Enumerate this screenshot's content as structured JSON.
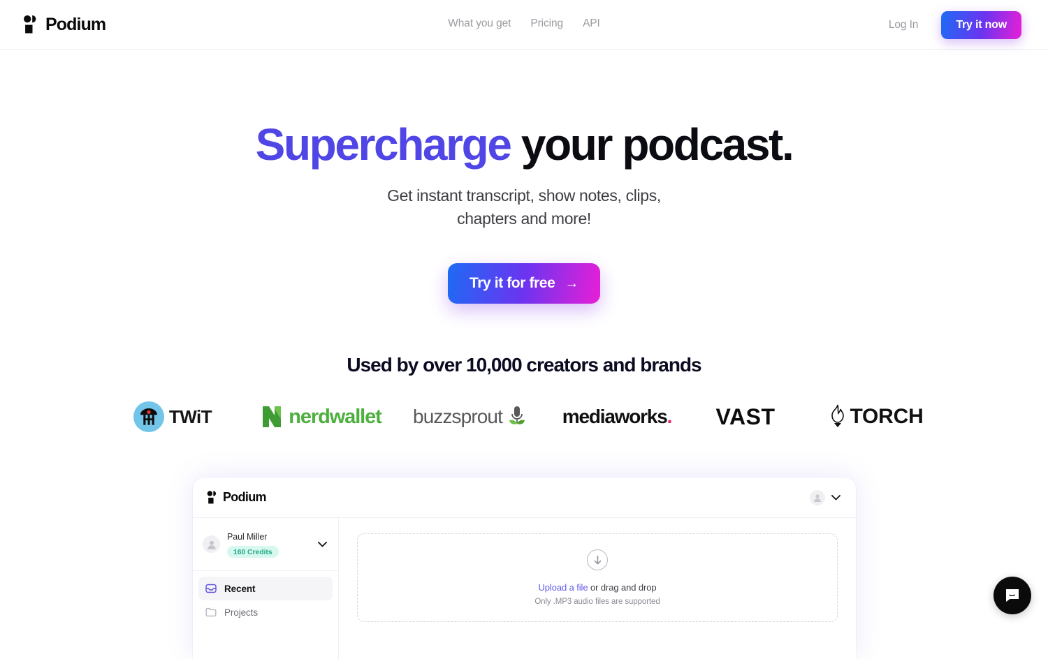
{
  "nav": {
    "brand": "Podium",
    "links": [
      {
        "label": "What you get"
      },
      {
        "label": "Pricing"
      },
      {
        "label": "API"
      }
    ],
    "login_label": "Log In",
    "cta_label": "Try it now"
  },
  "hero": {
    "headline_accent": "Supercharge",
    "headline_rest": " your podcast.",
    "accent_color": "#5046e5",
    "subhead_line1": "Get instant transcript, show notes, clips,",
    "subhead_line2": "chapters and more!",
    "cta_label": "Try it for free",
    "cta_arrow": "→"
  },
  "social_proof": {
    "title": "Used by over 10,000 creators and brands",
    "logos": [
      {
        "name": "TWiT",
        "text": "TWiT",
        "color": "#151515"
      },
      {
        "name": "nerdwallet",
        "text": "nerdwallet",
        "color": "#4caf3e"
      },
      {
        "name": "buzzsprout",
        "text": "buzzsprout",
        "color": "#58595b"
      },
      {
        "name": "mediaworks",
        "text": "mediaworks",
        "color": "#101010",
        "dot": "."
      },
      {
        "name": "VAST",
        "text": "VAST",
        "color": "#0c0c0c"
      },
      {
        "name": "TORCH",
        "text": "TORCH",
        "color": "#111111"
      }
    ]
  },
  "app_preview": {
    "brand": "Podium",
    "user": {
      "name": "Paul Miller",
      "credits_badge": "160 Credits"
    },
    "sidebar": [
      {
        "label": "Recent",
        "icon": "inbox-icon",
        "active": true
      },
      {
        "label": "Projects",
        "icon": "folder-icon",
        "active": false
      }
    ],
    "dropzone": {
      "link_text": "Upload a file",
      "rest_text": " or drag and drop",
      "hint": "Only .MP3 audio files are supported"
    }
  },
  "support": {
    "launcher_label": "Open Intercom Messenger"
  }
}
